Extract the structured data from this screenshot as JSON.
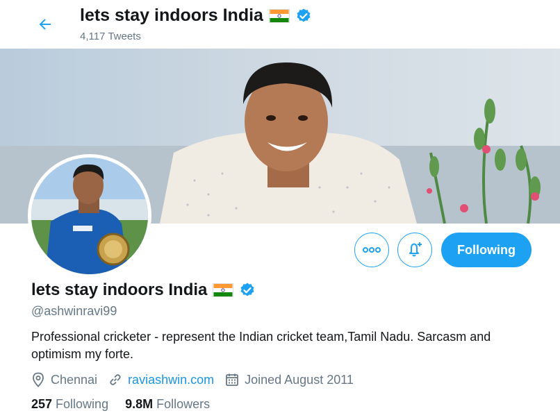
{
  "header": {
    "title": "lets stay indoors India",
    "tweet_count": "4,117 Tweets"
  },
  "profile": {
    "name": "lets stay indoors India",
    "handle": "@ashwinravi99",
    "bio": "Professional cricketer - represent the Indian cricket team,Tamil Nadu. Sarcasm and optimism my forte.",
    "location": "Chennai",
    "website": "raviashwin.com",
    "joined": "Joined August 2011",
    "following_count": "257",
    "following_label": "Following",
    "followers_count": "9.8M",
    "followers_label": "Followers"
  },
  "actions": {
    "follow_label": "Following"
  },
  "icons": {
    "back": "arrow-left-icon",
    "more": "more-dots-icon",
    "notify": "bell-plus-icon",
    "verified": "verified-badge-icon",
    "flag": "india-flag-icon",
    "location": "location-pin-icon",
    "link": "link-icon",
    "calendar": "calendar-icon"
  },
  "colors": {
    "accent": "#1da1f2",
    "link": "#1b95e0",
    "muted": "#657786",
    "text": "#14171a"
  }
}
